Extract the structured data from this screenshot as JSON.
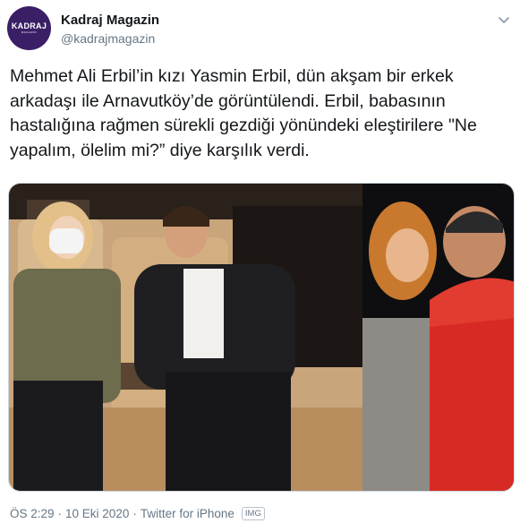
{
  "account": {
    "avatar_logo": "KADRAJ",
    "avatar_sub": "MAGAZİN",
    "display_name": "Kadraj Magazin",
    "handle": "@kadrajmagazin"
  },
  "tweet": {
    "text": "Mehmet Ali Erbil’in kızı Yasmin Erbil, dün akşam bir erkek arkadaşı ile Arnavutköy’de görüntülendi. Erbil, babasının hastalığına rağmen sürekli gezdiği yönündeki eleştirilere \"Ne yapalım, ölelim mi?” diye karşılık verdi."
  },
  "meta": {
    "time": "ÖS 2:29",
    "separator1": "·",
    "date": "10 Eki 2020",
    "separator2": "·",
    "source": "Twitter for iPhone",
    "badge": "IMG"
  },
  "colors": {
    "avatar_bg": "#3a1f66",
    "secondary_text": "#657786",
    "primary_text": "#14171a"
  },
  "icons": [
    "chevron-down-icon"
  ]
}
